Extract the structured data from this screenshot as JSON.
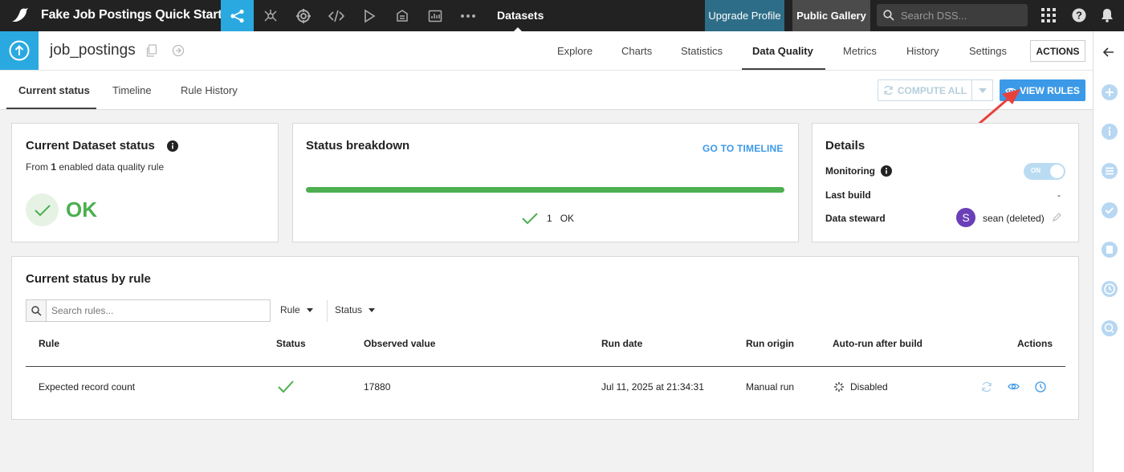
{
  "topbar": {
    "project_title": "Fake Job Postings Quick Start",
    "datasets_label": "Datasets",
    "upgrade_label": "Upgrade Profile",
    "gallery_label": "Public Gallery",
    "search_placeholder": "Search DSS..."
  },
  "dataset": {
    "name": "job_postings",
    "tabs": [
      "Explore",
      "Charts",
      "Statistics",
      "Data Quality",
      "Metrics",
      "History",
      "Settings"
    ],
    "active_tab": "Data Quality",
    "actions_label": "ACTIONS"
  },
  "subtabs": {
    "items": [
      "Current status",
      "Timeline",
      "Rule History"
    ],
    "active": "Current status",
    "compute_all_label": "COMPUTE ALL",
    "view_rules_label": "VIEW RULES"
  },
  "current_status": {
    "title": "Current Dataset status",
    "subtitle_prefix": "From ",
    "rule_count": "1",
    "subtitle_suffix": " enabled data quality rule",
    "status": "OK"
  },
  "breakdown": {
    "title": "Status breakdown",
    "goto_label": "GO TO TIMELINE",
    "ok_fraction": 1.0,
    "ok_count": "1",
    "ok_label": "OK"
  },
  "details": {
    "title": "Details",
    "monitoring_label": "Monitoring",
    "monitoring_toggle": "ON",
    "last_build_label": "Last build",
    "last_build_value": "-",
    "steward_label": "Data steward",
    "steward_initial": "S",
    "steward_name": "sean (deleted)"
  },
  "rules_table": {
    "title": "Current status by rule",
    "search_placeholder": "Search rules...",
    "rule_filter": "Rule",
    "status_filter": "Status",
    "columns": [
      "Rule",
      "Status",
      "Observed value",
      "Run date",
      "Run origin",
      "Auto-run after build",
      "Actions"
    ],
    "rows": [
      {
        "rule": "Expected record count",
        "status": "ok",
        "observed": "17880",
        "run_date": "Jul 11, 2025 at 21:34:31",
        "run_origin": "Manual run",
        "auto_run": "Disabled"
      }
    ]
  },
  "colors": {
    "accent": "#2aa9e0",
    "primary_button": "#3b99e8",
    "ok_green": "#4caf50",
    "arrow_red": "#e8413c"
  }
}
